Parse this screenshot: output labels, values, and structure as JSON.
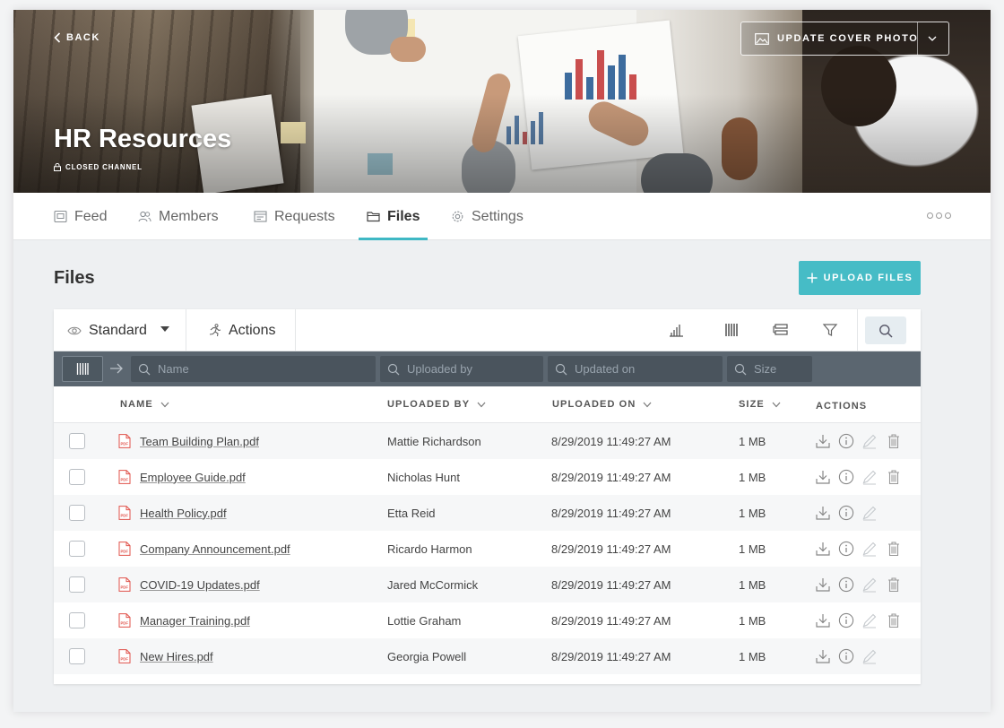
{
  "cover": {
    "back_label": "BACK",
    "update_cover_label": "UPDATE COVER PHOTO",
    "title": "HR Resources",
    "subtitle": "CLOSED CHANNEL"
  },
  "tabs": [
    {
      "label": "Feed",
      "icon": "feed-icon",
      "active": false
    },
    {
      "label": "Members",
      "icon": "members-icon",
      "active": false
    },
    {
      "label": "Requests",
      "icon": "requests-icon",
      "active": false
    },
    {
      "label": "Files",
      "icon": "folder-icon",
      "active": true
    },
    {
      "label": "Settings",
      "icon": "gear-icon",
      "active": false
    }
  ],
  "files_section": {
    "title": "Files",
    "upload_label": "UPLOAD FILES"
  },
  "toolbar": {
    "view_label": "Standard",
    "actions_label": "Actions"
  },
  "filters": {
    "name_placeholder": "Name",
    "uploaded_by_placeholder": "Uploaded by",
    "updated_on_placeholder": "Updated on",
    "size_placeholder": "Size"
  },
  "columns": {
    "name": "NAME",
    "uploaded_by": "UPLOADED BY",
    "uploaded_on": "UPLOADED ON",
    "size": "SIZE",
    "actions": "ACTIONS"
  },
  "rows": [
    {
      "name": "Team Building Plan.pdf",
      "uploaded_by": "Mattie Richardson",
      "uploaded_on": "8/29/2019 11:49:27 AM",
      "size": "1 MB",
      "deletable": true
    },
    {
      "name": "Employee Guide.pdf",
      "uploaded_by": "Nicholas Hunt",
      "uploaded_on": "8/29/2019 11:49:27 AM",
      "size": "1 MB",
      "deletable": true
    },
    {
      "name": "Health Policy.pdf",
      "uploaded_by": "Etta Reid",
      "uploaded_on": "8/29/2019 11:49:27 AM",
      "size": "1 MB",
      "deletable": false
    },
    {
      "name": "Company Announcement.pdf",
      "uploaded_by": "Ricardo Harmon",
      "uploaded_on": "8/29/2019 11:49:27 AM",
      "size": "1 MB",
      "deletable": true
    },
    {
      "name": "COVID-19 Updates.pdf",
      "uploaded_by": "Jared McCormick",
      "uploaded_on": "8/29/2019 11:49:27 AM",
      "size": "1 MB",
      "deletable": true
    },
    {
      "name": "Manager Training.pdf",
      "uploaded_by": "Lottie Graham",
      "uploaded_on": "8/29/2019 11:49:27 AM",
      "size": "1 MB",
      "deletable": true
    },
    {
      "name": "New Hires.pdf",
      "uploaded_by": "Georgia Powell",
      "uploaded_on": "8/29/2019 11:49:27 AM",
      "size": "1 MB",
      "deletable": false
    }
  ],
  "colors": {
    "accent": "#46bcc6",
    "filter_bar": "#5b6670",
    "pdf_icon": "#e0524a"
  }
}
